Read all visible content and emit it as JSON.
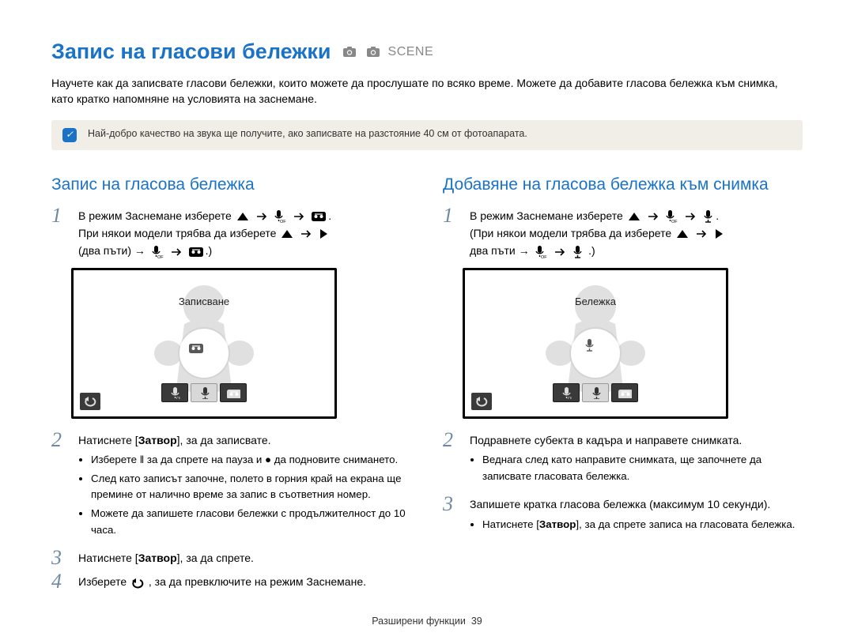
{
  "page_title": "Запис на гласови бележки",
  "scene_text": "SCENE",
  "intro_text": "Научете как да записвате гласови бележки, които можете да прослушате по всяко време. Можете да добавите гласова бележка към снимка, като кратко напомняне на условията на заснемане.",
  "note_text": "Най-добро качество на звука ще получите, ако записвате на разстояние 40 см от фотоапарата.",
  "left": {
    "heading": "Запис на гласова бележка",
    "step1_line1_a": "В режим Заснемане изберете ",
    "step1_line2_a": "При някои модели трябва да изберете ",
    "step1_line2_b": "(два пъти) → ",
    "shot_label": "Записване",
    "step2_text_a": "Натиснете [",
    "step2_text_b": "Затвор",
    "step2_text_c": "], за да записвате.",
    "step2_bullets": [
      "Изберете ‖ за да спрете на пауза и ● да подновите снимането.",
      "След като записът започне, полето в горния край на екрана ще премине от налично време за запис в съответния номер.",
      "Можете да запишете гласови бележки с продължителност до 10 часа."
    ],
    "step3_text_a": "Натиснете [",
    "step3_text_b": "Затвор",
    "step3_text_c": "], за да спрете.",
    "step4_text_a": "Изберете ",
    "step4_text_b": ", за да превключите на режим Заснемане."
  },
  "right": {
    "heading": "Добавяне на гласова бележка към снимка",
    "step1_line1_a": "В режим Заснемане изберете ",
    "step1_line2_a": "(При някои модели трябва да изберете ",
    "step1_line2_b": "два пъти → ",
    "step1_line2_c": " .)",
    "shot_label": "Бележка",
    "step2_text": "Подравнете субекта в кадъра и направете снимката.",
    "step2_bullets": [
      "Веднага след като направите снимката, ще започнете да записвате гласовата бележка."
    ],
    "step3_text": "Запишете кратка гласова бележка (максимум 10 секунди).",
    "step3_bullets_a": "Натиснете [",
    "step3_bullets_b": "Затвор",
    "step3_bullets_c": "], за да спрете записа на гласовата бележка."
  },
  "footer_label": "Разширени функции",
  "footer_page": "39"
}
